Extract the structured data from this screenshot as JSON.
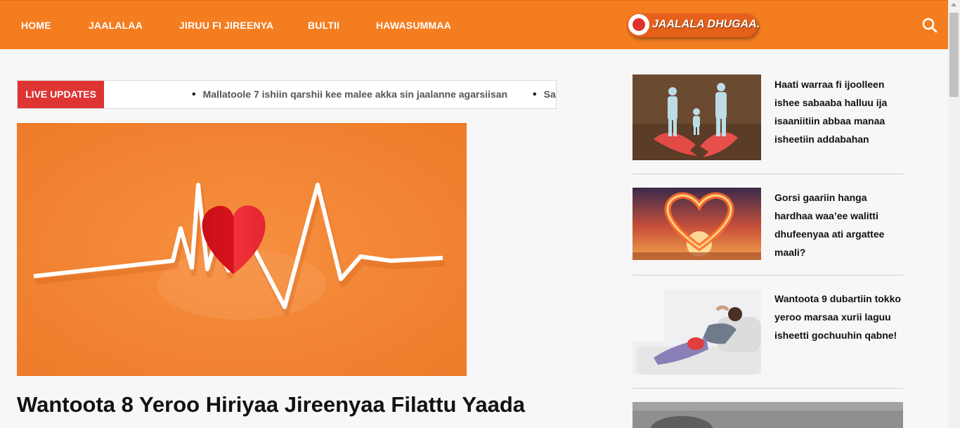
{
  "nav": {
    "items": [
      {
        "label": "HOME"
      },
      {
        "label": "JAALALAA"
      },
      {
        "label": "JIRUU FI JIREENYA"
      },
      {
        "label": "BULTII"
      },
      {
        "label": "HAWASUMMAA"
      }
    ],
    "brand_logo_text": "JAALALA DHUGAA.",
    "search_icon": "search-icon"
  },
  "ticker": {
    "label": "LIVE UPDATES",
    "items": [
      "Mallatoole 7 ishiin qarshii kee malee akka sin jaalanne agarsiisan",
      "Sa"
    ]
  },
  "featured": {
    "image": "heartbeat-heart-illustration",
    "title": "Wantoota 8 Yeroo Hiriyaa Jireenyaa Filattu Yaada"
  },
  "sidebar": {
    "articles": [
      {
        "title": "Haati warraa fi ijoolleen ishee sabaaba halluu ija isaaniitiin abbaa manaa isheetiin addabahan",
        "image": "paper-family-broken-heart"
      },
      {
        "title": "Gorsi gaariin hanga hardhaa waa’ee walitti dhufeenyaa ati argattee maali?",
        "image": "fire-heart-sunset"
      },
      {
        "title": "Wantoota 9 dubartiin tokko yeroo marsaa xurii laguu isheetti gochuuhin qabne!",
        "image": "woman-hot-water-bottle"
      },
      {
        "title": "",
        "image": "gray-photo-partial"
      }
    ]
  },
  "colors": {
    "brand_orange": "#f47d20",
    "live_red": "#de3433"
  }
}
